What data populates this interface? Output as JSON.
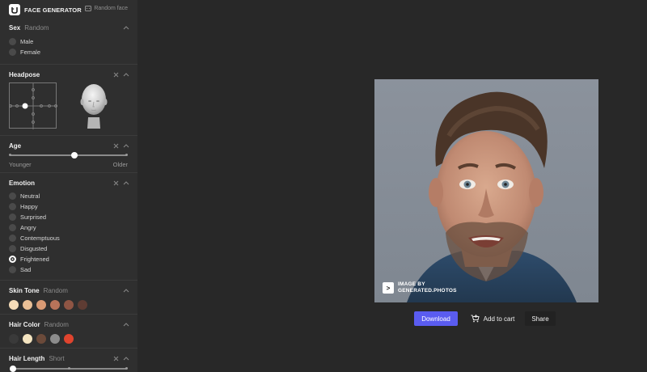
{
  "app": {
    "brand": "FACE GENERATOR",
    "random_face": "Random face"
  },
  "sections": {
    "sex": {
      "title": "Sex",
      "sub": "Random",
      "options": [
        "Male",
        "Female"
      ]
    },
    "headpose": {
      "title": "Headpose"
    },
    "age": {
      "title": "Age",
      "min_label": "Younger",
      "max_label": "Older",
      "value": 0.55
    },
    "emotion": {
      "title": "Emotion",
      "options": [
        "Neutral",
        "Happy",
        "Surprised",
        "Angry",
        "Contemptuous",
        "Disgusted",
        "Frightened",
        "Sad"
      ],
      "selected": "Frightened"
    },
    "skin_tone": {
      "title": "Skin Tone",
      "sub": "Random",
      "swatches": [
        "#f5dcb8",
        "#eabf96",
        "#d99a74",
        "#b8735a",
        "#8f5544",
        "#5e3c33"
      ]
    },
    "hair_color": {
      "title": "Hair Color",
      "sub": "Random",
      "swatches": [
        "#3a3a3a",
        "#f4e4c0",
        "#6b4a3a",
        "#8c8c8c",
        "#e0442e"
      ]
    },
    "hair_length": {
      "title": "Hair Length",
      "sub": "Short"
    }
  },
  "photo": {
    "watermark_line1": "IMAGE BY",
    "watermark_line2": "GENERATED.PHOTOS"
  },
  "actions": {
    "download": "Download",
    "add_to_cart": "Add to cart",
    "share": "Share"
  }
}
